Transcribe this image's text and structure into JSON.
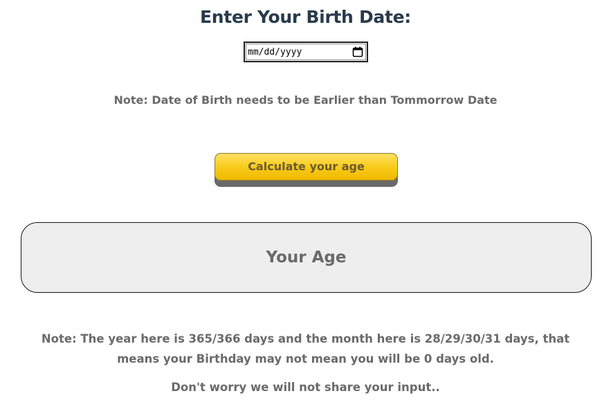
{
  "heading": "Enter Your Birth Date:",
  "date_input": {
    "placeholder": "mm/dd/yyyy",
    "value": "",
    "icon": "calendar-icon"
  },
  "note_tomorrow": "Note: Date of Birth needs to be Earlier than Tommorrow Date",
  "calculate_button": {
    "label": "Calculate your age"
  },
  "result": {
    "label": "Your Age"
  },
  "note_year_month": "Note: The year here is 365/366 days and the month here is 28/29/30/31 days, that means your Birthday may not mean you will be 0 days old.",
  "note_privacy": "Don't worry we will not share your input..",
  "colors": {
    "heading": "#283a4b",
    "note_text": "#6a6a6a",
    "button_yellow": "#f8cc1a",
    "button_text": "#6b5a34",
    "button_shadow": "#6a6a6a",
    "result_bg": "#eeeeee"
  }
}
